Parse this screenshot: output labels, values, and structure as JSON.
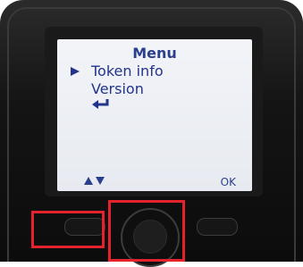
{
  "menu": {
    "title": "Menu",
    "items": [
      {
        "label": "Token info",
        "selected": true
      },
      {
        "label": "Version",
        "selected": false
      }
    ],
    "back_icon": "return-arrow-icon"
  },
  "softkeys": {
    "left_icon": "up-down-arrows-icon",
    "right_label": "OK"
  },
  "hardware": {
    "left_softkey_button": "left-softkey-button",
    "navigation_button": "navigation-button",
    "right_softkey_button": "right-softkey-button"
  },
  "colors": {
    "screen_text": "#2b3f8f",
    "screen_background": "#eef0f4",
    "device_body": "#141414",
    "highlight": "#e3222b"
  }
}
